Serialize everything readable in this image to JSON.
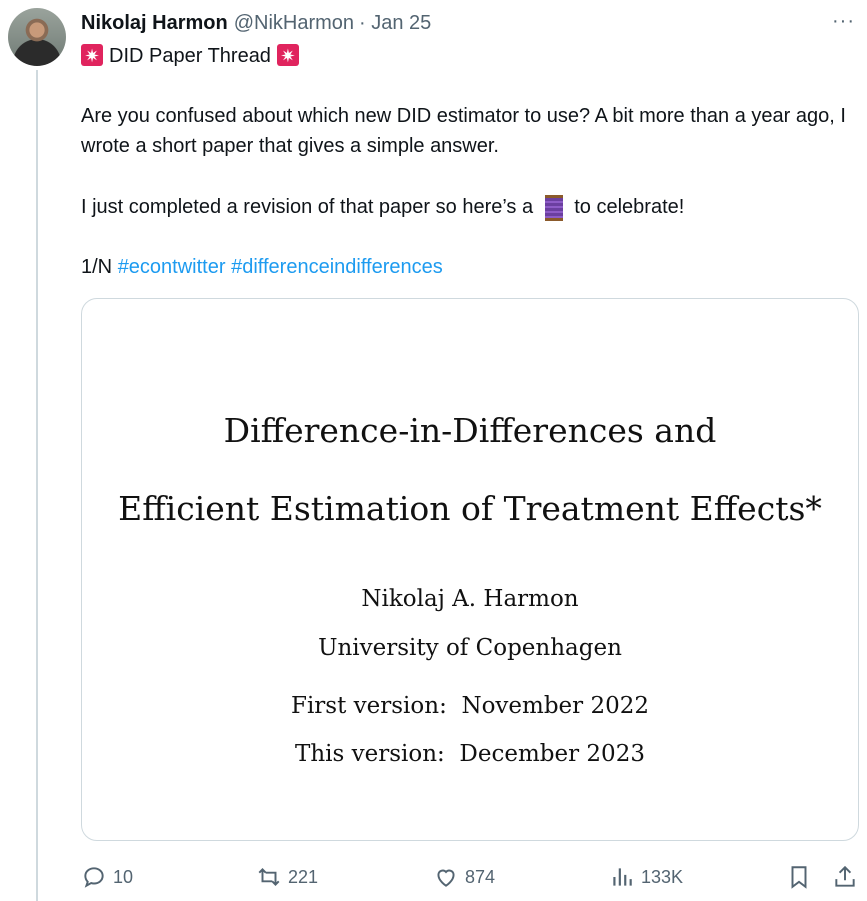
{
  "author": {
    "name": "Nikolaj Harmon",
    "handle": "@NikHarmon",
    "date": "· Jan 25"
  },
  "thread_title": "DID Paper Thread",
  "tweet": {
    "p1": "Are you confused about which new DID estimator to use? A bit more than a year ago, I wrote a short paper that gives a simple answer.",
    "p2_before": "I just completed a revision of that paper so here’s a",
    "p2_after": "to celebrate!",
    "p3_prefix": "1/N",
    "hashtags": [
      "#econtwitter",
      "#differenceindifferences"
    ]
  },
  "paper": {
    "title_line1": "Difference-in-Differences and",
    "title_line2": "Efficient Estimation of Treatment Effects*",
    "author": "Nikolaj A. Harmon",
    "affiliation": "University of Copenhagen",
    "first_version": "First version:  November 2022",
    "this_version": "This version:  December 2023"
  },
  "actions": {
    "replies": "10",
    "retweets": "221",
    "likes": "874",
    "views": "133K"
  },
  "icons": {
    "siren": "police-car-light-emoji",
    "thread": "spool-of-thread-emoji",
    "more": "more-dots-icon"
  },
  "colors": {
    "link": "#1d9bf0",
    "secondary_text": "#536471",
    "border": "#cfd9de"
  }
}
